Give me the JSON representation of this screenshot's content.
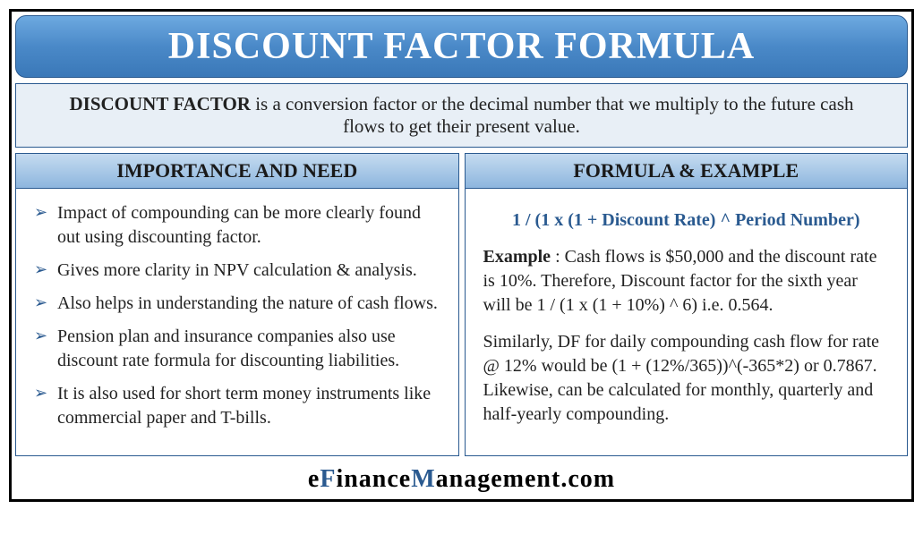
{
  "title": "DISCOUNT FACTOR FORMULA",
  "definition": {
    "bold": "DISCOUNT FACTOR",
    "rest": " is a conversion factor or the decimal number that we multiply to the future cash flows to get their present value."
  },
  "left": {
    "header": "IMPORTANCE AND NEED",
    "bullets": [
      "Impact of compounding can be more clearly found out using discounting factor.",
      "Gives more clarity in NPV calculation & analysis.",
      "Also helps in understanding the nature of cash flows.",
      "Pension plan and insurance companies also use discount rate formula for discounting liabilities.",
      "It is also used for short term money instruments like commercial paper and T-bills."
    ]
  },
  "right": {
    "header": "FORMULA & EXAMPLE",
    "formula": "1 / (1 x (1 + Discount Rate) ^ Period Number)",
    "example_label": "Example",
    "example_body": " : Cash flows is $50,000 and the discount rate is 10%. Therefore, Discount factor for the sixth year will be 1 / (1 x (1 + 10%) ^ 6) i.e. 0.564.",
    "para2": "Similarly, DF for daily compounding cash flow for rate @ 12% would be (1 + (12%/365))^(-365*2) or 0.7867. Likewise, can be calculated for monthly, quarterly and half-yearly compounding."
  },
  "footer": {
    "e1": "e",
    "f": "F",
    "inance": "inance",
    "m": "M",
    "anagement": "anagement.com"
  }
}
